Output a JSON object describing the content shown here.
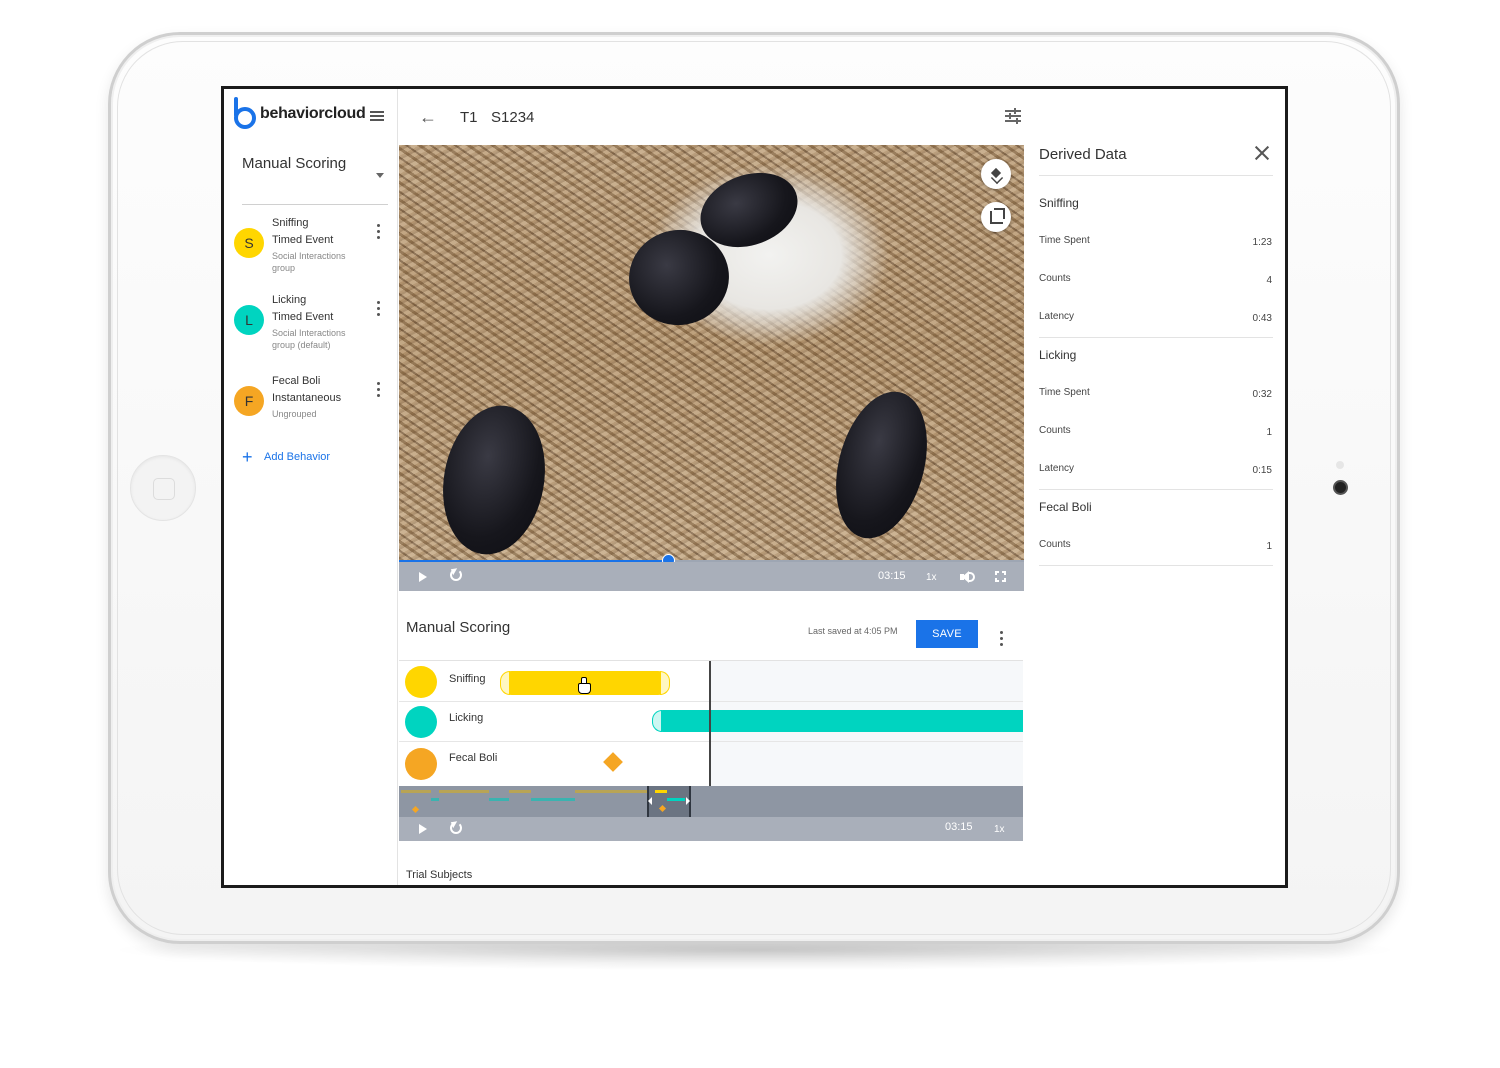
{
  "app": {
    "brand": "behaviorcloud",
    "accent_color": "#1a73e8"
  },
  "sidebar": {
    "mode_label": "Manual Scoring",
    "behaviors": [
      {
        "letter": "S",
        "name": "Sniffing",
        "type": "Timed Event",
        "group": "Social Interactions group",
        "color": "#ffd600"
      },
      {
        "letter": "L",
        "name": "Licking",
        "type": "Timed Event",
        "group": "Social Interactions group (default)",
        "color": "#00d4c0"
      },
      {
        "letter": "F",
        "name": "Fecal Boli",
        "type": "Instantaneous",
        "group": "Ungrouped",
        "color": "#f5a623"
      }
    ],
    "add_behavior_label": "Add Behavior"
  },
  "header": {
    "trial": "T1",
    "subject": "S1234"
  },
  "video": {
    "time": "03:15",
    "speed": "1x",
    "progress": 0.43
  },
  "scoring": {
    "title": "Manual Scoring",
    "last_saved": "Last saved at 4:05 PM",
    "save_label": "SAVE",
    "tracks": [
      "Sniffing",
      "Licking",
      "Fecal Boli"
    ],
    "overview_time": "03:15",
    "overview_speed": "1x"
  },
  "footer": {
    "trial_subjects_label": "Trial Subjects"
  },
  "derived": {
    "title": "Derived Data",
    "sections": [
      {
        "name": "Sniffing",
        "rows": [
          {
            "key": "Time Spent",
            "value": "1:23"
          },
          {
            "key": "Counts",
            "value": "4"
          },
          {
            "key": "Latency",
            "value": "0:43"
          }
        ]
      },
      {
        "name": "Licking",
        "rows": [
          {
            "key": "Time Spent",
            "value": "0:32"
          },
          {
            "key": "Counts",
            "value": "1"
          },
          {
            "key": "Latency",
            "value": "0:15"
          }
        ]
      },
      {
        "name": "Fecal Boli",
        "rows": [
          {
            "key": "Counts",
            "value": "1"
          }
        ]
      }
    ]
  }
}
